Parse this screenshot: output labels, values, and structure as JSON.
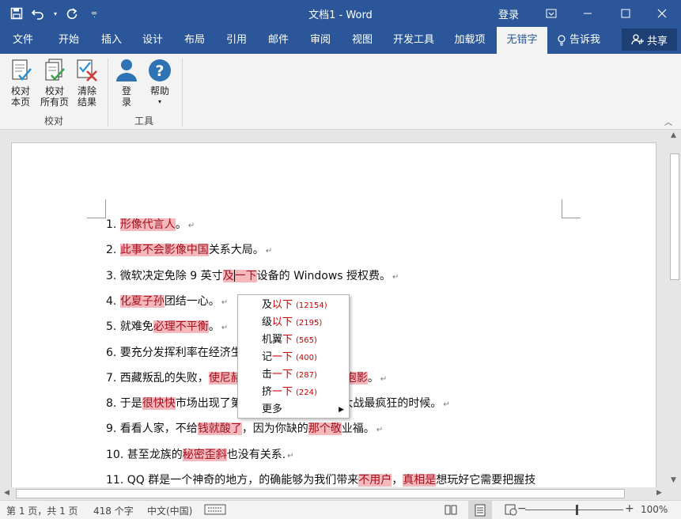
{
  "window": {
    "title": "文档1  -  Word",
    "login": "登录"
  },
  "tabs": [
    {
      "label": "文件"
    },
    {
      "label": "开始"
    },
    {
      "label": "插入"
    },
    {
      "label": "设计"
    },
    {
      "label": "布局"
    },
    {
      "label": "引用"
    },
    {
      "label": "邮件"
    },
    {
      "label": "审阅"
    },
    {
      "label": "视图"
    },
    {
      "label": "开发工具"
    },
    {
      "label": "加载项"
    },
    {
      "label": "无错字"
    }
  ],
  "tell_me": "告诉我",
  "share": "共享",
  "ribbon": {
    "buttons": [
      {
        "line1": "校对",
        "line2": "本页"
      },
      {
        "line1": "校对",
        "line2": "所有页"
      },
      {
        "line1": "清除",
        "line2": "结果"
      },
      {
        "line1": "登",
        "line2": "录"
      },
      {
        "line1": "帮助",
        "line2": "▾"
      }
    ],
    "groups": [
      "校对",
      "工具"
    ]
  },
  "document": {
    "lines": [
      [
        {
          "t": "1. "
        },
        {
          "t": "形像代言人",
          "e": 1
        },
        {
          "t": "。"
        }
      ],
      [
        {
          "t": "2. "
        },
        {
          "t": "此事",
          "e": 1
        },
        {
          "t": "不会",
          "e": 1
        },
        {
          "t": "影像中国",
          "e": 1
        },
        {
          "t": "关系大局。"
        }
      ],
      [
        {
          "t": "3. 微软决定免除 9 英寸"
        },
        {
          "t": "及",
          "e": 1
        },
        {
          "t": "|",
          "c": 1
        },
        {
          "t": "一下",
          "e": 1
        },
        {
          "t": "设备的 Windows 授权费。"
        }
      ],
      [
        {
          "t": "4. "
        },
        {
          "t": "化夏子孙",
          "e": 1
        },
        {
          "t": "团结一心。"
        }
      ],
      [
        {
          "t": "5. 就难免"
        },
        {
          "t": "必理不平衡",
          "e": 1
        },
        {
          "t": "。"
        }
      ],
      [
        {
          "t": "6. 要充分发挥利率在经济生"
        }
      ],
      [
        {
          "t": "7. 西藏叛乱的失败，"
        },
        {
          "t": "使尼赫",
          "e": 1
        },
        {
          "t": "                    想"
        },
        {
          "t": "华为泡影",
          "e": 1
        },
        {
          "t": "。"
        }
      ],
      [
        {
          "t": "8. 于是"
        },
        {
          "t": "很快快",
          "e": 1
        },
        {
          "t": "市场出现了第"
        },
        {
          "t": "                   是补贴大战最疯狂的时候。"
        }
      ],
      [
        {
          "t": "9. 看看人家，不给"
        },
        {
          "t": "钱就酸了",
          "e": 1
        },
        {
          "t": "，因为你缺的"
        },
        {
          "t": "那个敬",
          "e": 1
        },
        {
          "t": "业福。"
        }
      ],
      [
        {
          "t": "10. 甚至龙族的"
        },
        {
          "t": "秘密歪斜",
          "e": 1
        },
        {
          "t": "也没有关系."
        }
      ],
      [
        {
          "t": "11. QQ 群是一个神奇的地方，的确能够为我们带来"
        },
        {
          "t": "不用户",
          "e": 1
        },
        {
          "t": "，"
        },
        {
          "t": "真相是",
          "e": 1
        },
        {
          "t": "想玩好它需要把握技"
        }
      ]
    ]
  },
  "context_menu": {
    "items": [
      {
        "prefix": "及",
        "red": "以下",
        "count": "(12154)"
      },
      {
        "prefix": "级",
        "red": "以下",
        "count": "(2195)"
      },
      {
        "prefix": "机翼",
        "red": "下",
        "count": "(565)"
      },
      {
        "prefix": "记",
        "red": "一下",
        "count": "(400)"
      },
      {
        "prefix": "击",
        "red": "一下",
        "count": "(287)"
      },
      {
        "prefix": "挤",
        "red": "一下",
        "count": "(224)"
      }
    ],
    "more": "更多"
  },
  "status": {
    "page": "第 1 页，共 1 页",
    "words": "418 个字",
    "lang": "中文(中国)",
    "zoom": "100%",
    "zoom_level": 100
  },
  "colors": {
    "accent": "#2b579a",
    "error_bg": "#f6b7bd",
    "error_text": "#a4111d",
    "menu_red": "#cc0000"
  }
}
